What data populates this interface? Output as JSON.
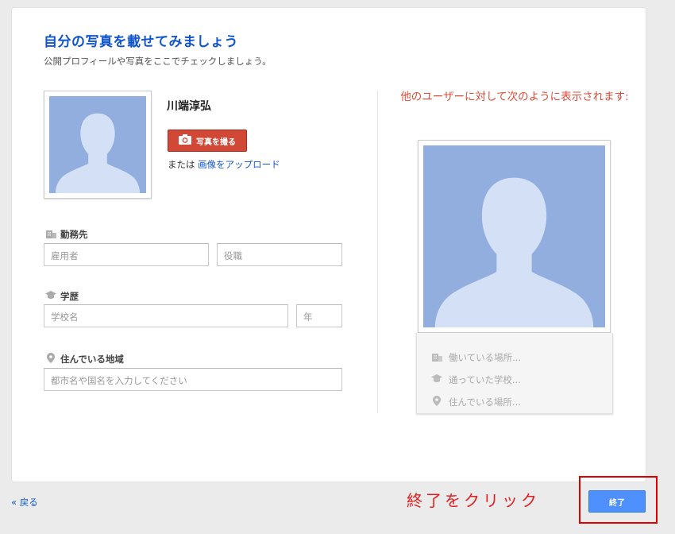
{
  "page": {
    "title": "自分の写真を載せてみましょう",
    "subtitle": "公開プロフィールや写真をここでチェックしましょう。"
  },
  "profile": {
    "name": "川端淳弘",
    "take_photo_label": "写真を撮る",
    "or_text": "または",
    "upload_link": "画像をアップロード"
  },
  "work": {
    "label": "勤務先",
    "employer_placeholder": "雇用者",
    "position_placeholder": "役職",
    "icon": "building-icon"
  },
  "education": {
    "label": "学歴",
    "school_placeholder": "学校名",
    "year_placeholder": "年",
    "icon": "graduation-cap-icon"
  },
  "location": {
    "label": "住んでいる地域",
    "city_placeholder": "都市名や国名を入力してください",
    "icon": "map-pin-icon"
  },
  "preview": {
    "note": "他のユーザーに対して次のように表示されます:",
    "rows": [
      {
        "icon": "building-icon",
        "text": "働いている場所..."
      },
      {
        "icon": "graduation-cap-icon",
        "text": "通っていた学校..."
      },
      {
        "icon": "map-pin-icon",
        "text": "住んでいる場所..."
      }
    ]
  },
  "footer": {
    "back_label": "« 戻る",
    "annotation": "終了をクリック",
    "finish_label": "終了"
  },
  "colors": {
    "accent_blue": "#1155cc",
    "photo_button": "#d14836",
    "finish_button": "#4d90fe",
    "annotation_red": "#e02020",
    "avatar_bg": "#92aedf"
  }
}
